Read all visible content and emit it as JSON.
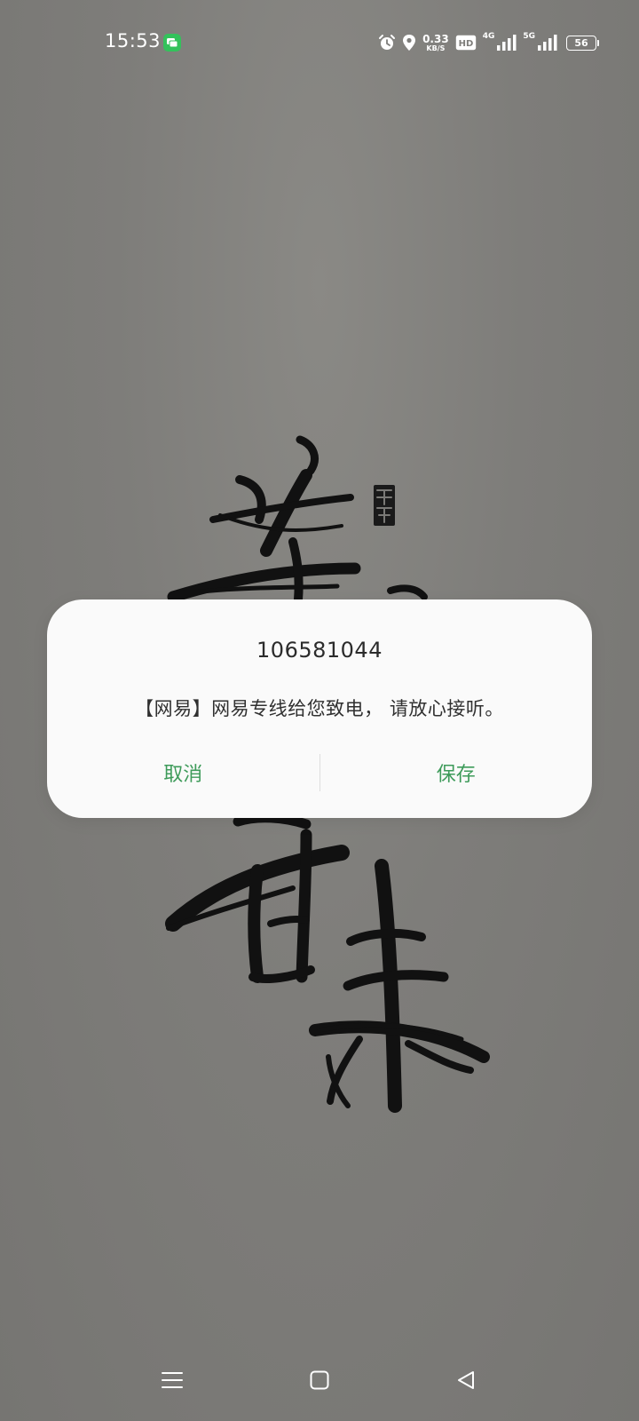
{
  "status_bar": {
    "time": "15:53",
    "net_speed_value": "0.33",
    "net_speed_unit": "KB/S",
    "hd_label": "HD",
    "network_1": "4G",
    "network_2": "5G",
    "battery": "56"
  },
  "dialog": {
    "title": "106581044",
    "message": "【网易】网易专线给您致电， 请放心接听。",
    "cancel_label": "取消",
    "save_label": "保存"
  },
  "colors": {
    "accent": "#3e9b5a",
    "dialog_bg": "#fafafa",
    "wallpaper": "#7e7d7a"
  },
  "icons": {
    "message_app": "message-app-icon",
    "alarm": "alarm-icon",
    "location": "location-icon",
    "signal": "signal-icon",
    "nav_menu": "menu-icon",
    "nav_home": "home-icon",
    "nav_back": "back-icon"
  }
}
